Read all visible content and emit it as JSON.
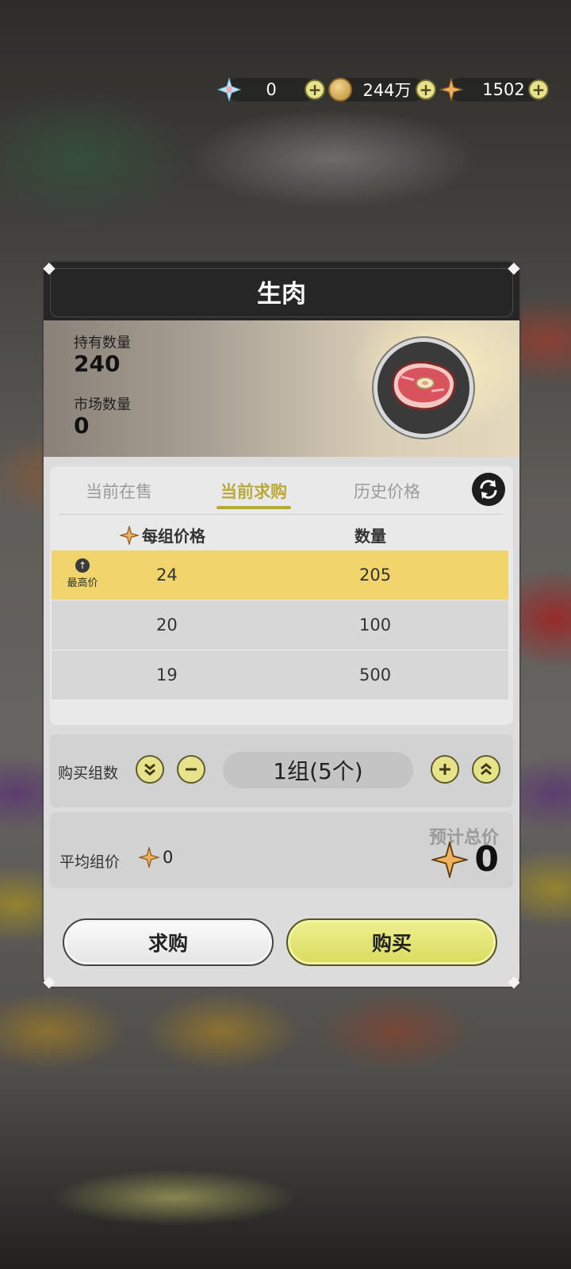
{
  "currency": {
    "primogem_value": "0",
    "mora_value": "244万",
    "star_value": "1502"
  },
  "modal": {
    "title": "生肉",
    "owned_label": "持有数量",
    "owned_value": "240",
    "market_label": "市场数量",
    "market_value": "0"
  },
  "tabs": [
    {
      "label": "当前在售",
      "active": false
    },
    {
      "label": "当前求购",
      "active": true
    },
    {
      "label": "历史价格",
      "active": false
    }
  ],
  "table": {
    "col_price": "每组价格",
    "col_qty": "数量",
    "top_badge": "最高价",
    "rows": [
      {
        "price": "24",
        "qty": "205",
        "highlight": true
      },
      {
        "price": "20",
        "qty": "100",
        "highlight": false
      },
      {
        "price": "19",
        "qty": "500",
        "highlight": false
      }
    ]
  },
  "purchase": {
    "label": "购买组数",
    "quantity": "1组(5个)",
    "avg_label": "平均组价",
    "avg_value": "0",
    "estimate_label": "预计总价",
    "estimate_value": "0"
  },
  "buttons": {
    "request": "求购",
    "buy": "购买"
  },
  "colors": {
    "accent": "#b8a93a",
    "highlight_row": "#f1d46c",
    "buy_button": "#e4e67a"
  }
}
